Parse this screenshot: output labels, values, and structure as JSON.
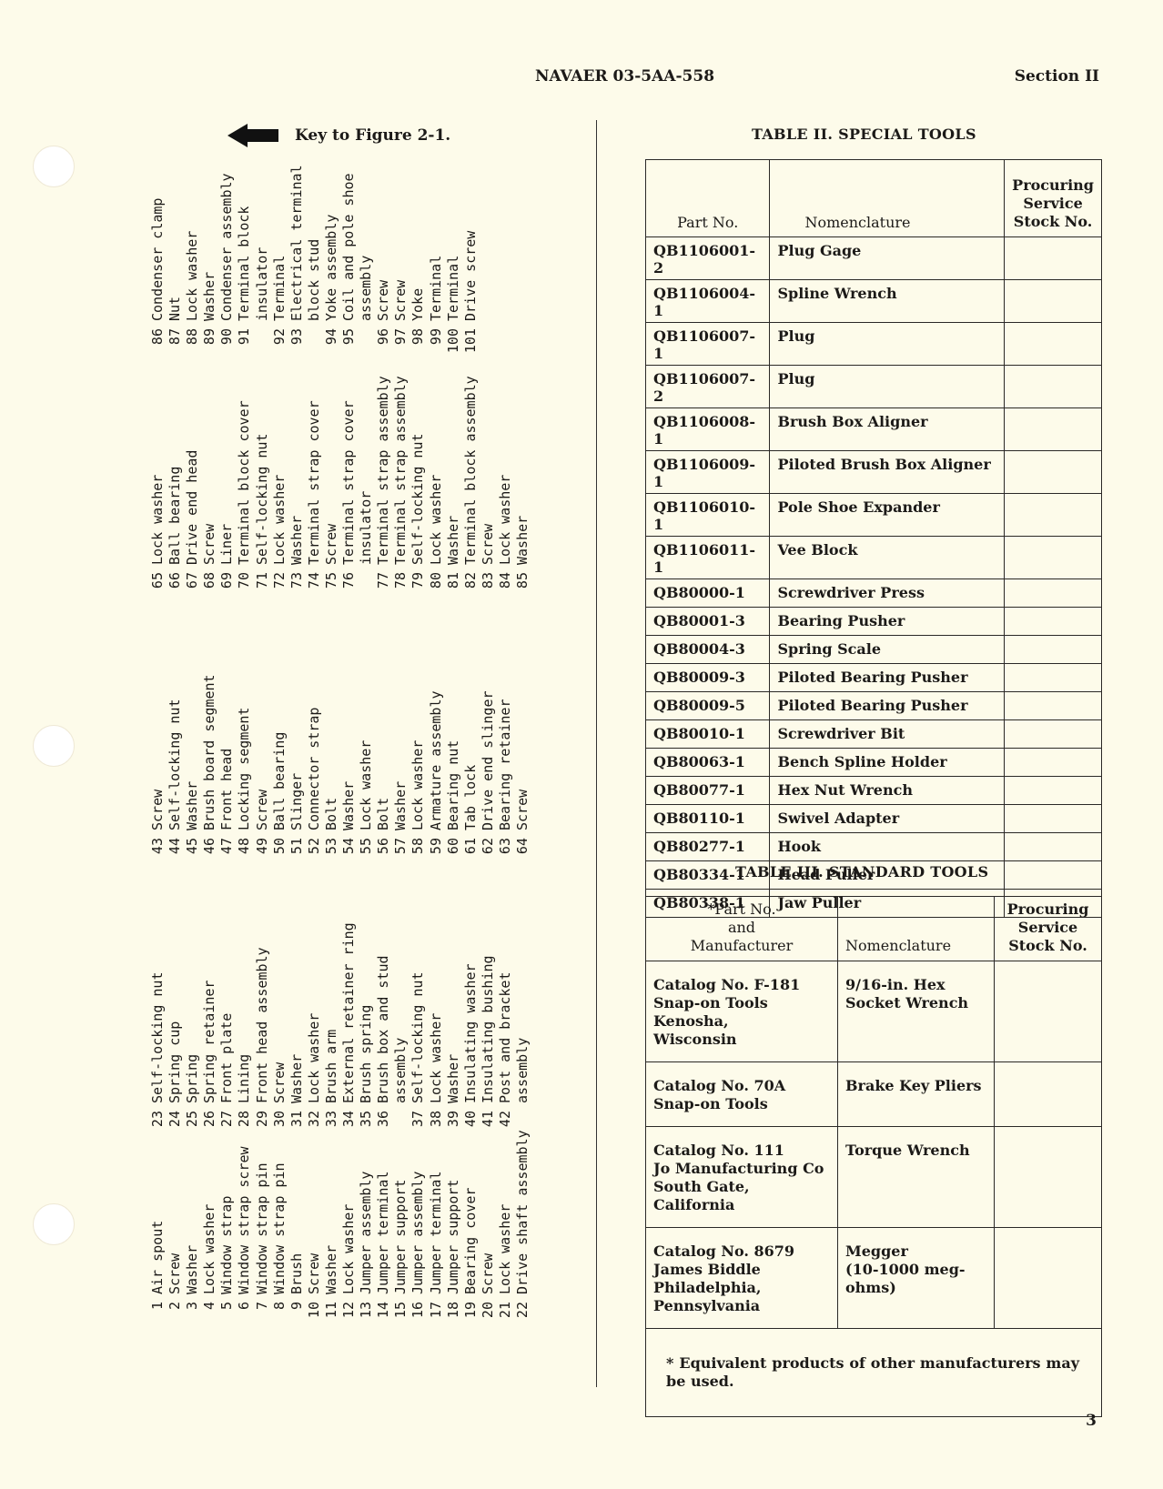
{
  "header": {
    "document_number": "NAVAER 03-5AA-558",
    "section": "Section II"
  },
  "key_heading": {
    "icon": "arrow-left-icon",
    "label": "Key to Figure 2-1."
  },
  "parts_list": {
    "col1": [
      {
        "n": "1",
        "t": "Air spout"
      },
      {
        "n": "2",
        "t": "Screw"
      },
      {
        "n": "3",
        "t": "Washer"
      },
      {
        "n": "4",
        "t": "Lock washer"
      },
      {
        "n": "5",
        "t": "Window strap"
      },
      {
        "n": "6",
        "t": "Window strap screw"
      },
      {
        "n": "7",
        "t": "Window strap pin"
      },
      {
        "n": "8",
        "t": "Window strap pin"
      },
      {
        "n": "9",
        "t": "Brush"
      },
      {
        "n": "10",
        "t": "Screw"
      },
      {
        "n": "11",
        "t": "Washer"
      },
      {
        "n": "12",
        "t": "Lock washer"
      },
      {
        "n": "13",
        "t": "Jumper assembly"
      },
      {
        "n": "14",
        "t": "Jumper terminal"
      },
      {
        "n": "15",
        "t": "Jumper support"
      },
      {
        "n": "16",
        "t": "Jumper assembly"
      },
      {
        "n": "17",
        "t": "Jumper terminal"
      },
      {
        "n": "18",
        "t": "Jumper support"
      },
      {
        "n": "19",
        "t": "Bearing cover"
      },
      {
        "n": "20",
        "t": "Screw"
      },
      {
        "n": "21",
        "t": "Lock washer"
      },
      {
        "n": "22",
        "t": "Drive shaft assembly"
      }
    ],
    "col2": [
      {
        "n": "23",
        "t": "Self-locking nut"
      },
      {
        "n": "24",
        "t": "Spring cup"
      },
      {
        "n": "25",
        "t": "Spring"
      },
      {
        "n": "26",
        "t": "Spring retainer"
      },
      {
        "n": "27",
        "t": "Front plate"
      },
      {
        "n": "28",
        "t": "Lining"
      },
      {
        "n": "29",
        "t": "Front head assembly"
      },
      {
        "n": "30",
        "t": "Screw"
      },
      {
        "n": "31",
        "t": "Washer"
      },
      {
        "n": "32",
        "t": "Lock washer"
      },
      {
        "n": "33",
        "t": "Brush arm"
      },
      {
        "n": "34",
        "t": "External retainer ring"
      },
      {
        "n": "35",
        "t": "Brush spring"
      },
      {
        "n": "36",
        "t": "Brush box and stud"
      },
      {
        "n": "",
        "t": "assembly"
      },
      {
        "n": "37",
        "t": "Self-locking nut"
      },
      {
        "n": "38",
        "t": "Lock washer"
      },
      {
        "n": "39",
        "t": "Washer"
      },
      {
        "n": "40",
        "t": "Insulating washer"
      },
      {
        "n": "41",
        "t": "Insulating bushing"
      },
      {
        "n": "42",
        "t": "Post and bracket"
      },
      {
        "n": "",
        "t": "assembly"
      }
    ],
    "col3": [
      {
        "n": "43",
        "t": "Screw"
      },
      {
        "n": "44",
        "t": "Self-locking nut"
      },
      {
        "n": "45",
        "t": "Washer"
      },
      {
        "n": "46",
        "t": "Brush board segment"
      },
      {
        "n": "47",
        "t": "Front head"
      },
      {
        "n": "48",
        "t": "Locking segment"
      },
      {
        "n": "49",
        "t": "Screw"
      },
      {
        "n": "50",
        "t": "Ball bearing"
      },
      {
        "n": "51",
        "t": "Slinger"
      },
      {
        "n": "52",
        "t": "Connector strap"
      },
      {
        "n": "53",
        "t": "Bolt"
      },
      {
        "n": "54",
        "t": "Washer"
      },
      {
        "n": "55",
        "t": "Lock washer"
      },
      {
        "n": "56",
        "t": "Bolt"
      },
      {
        "n": "57",
        "t": "Washer"
      },
      {
        "n": "58",
        "t": "Lock washer"
      },
      {
        "n": "59",
        "t": "Armature assembly"
      },
      {
        "n": "60",
        "t": "Bearing nut"
      },
      {
        "n": "61",
        "t": "Tab lock"
      },
      {
        "n": "62",
        "t": "Drive end slinger"
      },
      {
        "n": "63",
        "t": "Bearing retainer"
      },
      {
        "n": "64",
        "t": "Screw"
      }
    ],
    "col4": [
      {
        "n": "65",
        "t": "Lock washer"
      },
      {
        "n": "66",
        "t": "Ball bearing"
      },
      {
        "n": "67",
        "t": "Drive end head"
      },
      {
        "n": "68",
        "t": "Screw"
      },
      {
        "n": "69",
        "t": "Liner"
      },
      {
        "n": "70",
        "t": "Terminal block cover"
      },
      {
        "n": "71",
        "t": "Self-locking nut"
      },
      {
        "n": "72",
        "t": "Lock washer"
      },
      {
        "n": "73",
        "t": "Washer"
      },
      {
        "n": "74",
        "t": "Terminal strap cover"
      },
      {
        "n": "75",
        "t": "Screw"
      },
      {
        "n": "76",
        "t": "Terminal strap cover"
      },
      {
        "n": "",
        "t": "insulator"
      },
      {
        "n": "77",
        "t": "Terminal strap assembly"
      },
      {
        "n": "78",
        "t": "Terminal strap assembly"
      },
      {
        "n": "79",
        "t": "Self-locking nut"
      },
      {
        "n": "80",
        "t": "Lock washer"
      },
      {
        "n": "81",
        "t": "Washer"
      },
      {
        "n": "82",
        "t": "Terminal block assembly"
      },
      {
        "n": "83",
        "t": "Screw"
      },
      {
        "n": "84",
        "t": "Lock washer"
      },
      {
        "n": "85",
        "t": "Washer"
      }
    ],
    "col5": [
      {
        "n": "86",
        "t": "Condenser clamp"
      },
      {
        "n": "87",
        "t": "Nut"
      },
      {
        "n": "88",
        "t": "Lock washer"
      },
      {
        "n": "89",
        "t": "Washer"
      },
      {
        "n": "90",
        "t": "Condenser assembly"
      },
      {
        "n": "91",
        "t": "Terminal block"
      },
      {
        "n": "",
        "t": "insulator"
      },
      {
        "n": "92",
        "t": "Terminal"
      },
      {
        "n": "93",
        "t": "Electrical terminal"
      },
      {
        "n": "",
        "t": "block stud"
      },
      {
        "n": "94",
        "t": "Yoke assembly"
      },
      {
        "n": "95",
        "t": "Coil and pole shoe"
      },
      {
        "n": "",
        "t": "assembly"
      },
      {
        "n": "96",
        "t": "Screw"
      },
      {
        "n": "97",
        "t": "Screw"
      },
      {
        "n": "98",
        "t": "Yoke"
      },
      {
        "n": "99",
        "t": "Terminal"
      },
      {
        "n": "100",
        "t": "Terminal"
      },
      {
        "n": "101",
        "t": "Drive screw"
      }
    ]
  },
  "table2": {
    "title": "TABLE II.  SPECIAL TOOLS",
    "headers": [
      "Part No.",
      "Nomenclature",
      "Procuring Service Stock No."
    ],
    "header_lines": [
      "Procuring",
      "Service",
      "Stock No."
    ],
    "rows": [
      {
        "part": "QB1106001-2",
        "name": "Plug Gage",
        "stock": ""
      },
      {
        "part": "QB1106004-1",
        "name": "Spline Wrench",
        "stock": ""
      },
      {
        "part": "QB1106007-1",
        "name": "Plug",
        "stock": ""
      },
      {
        "part": "QB1106007-2",
        "name": "Plug",
        "stock": ""
      },
      {
        "part": "QB1106008-1",
        "name": "Brush Box Aligner",
        "stock": ""
      },
      {
        "part": "QB1106009-1",
        "name": "Piloted Brush Box Aligner",
        "stock": ""
      },
      {
        "part": "QB1106010-1",
        "name": "Pole Shoe Expander",
        "stock": ""
      },
      {
        "part": "QB1106011-1",
        "name": "Vee Block",
        "stock": ""
      },
      {
        "part": "QB80000-1",
        "name": "Screwdriver Press",
        "stock": ""
      },
      {
        "part": "QB80001-3",
        "name": "Bearing Pusher",
        "stock": ""
      },
      {
        "part": "QB80004-3",
        "name": "Spring Scale",
        "stock": ""
      },
      {
        "part": "QB80009-3",
        "name": "Piloted Bearing Pusher",
        "stock": ""
      },
      {
        "part": "QB80009-5",
        "name": "Piloted Bearing Pusher",
        "stock": ""
      },
      {
        "part": "QB80010-1",
        "name": "Screwdriver Bit",
        "stock": ""
      },
      {
        "part": "QB80063-1",
        "name": "Bench Spline Holder",
        "stock": ""
      },
      {
        "part": "QB80077-1",
        "name": "Hex Nut Wrench",
        "stock": ""
      },
      {
        "part": "QB80110-1",
        "name": "Swivel Adapter",
        "stock": ""
      },
      {
        "part": "QB80277-1",
        "name": "Hook",
        "stock": ""
      },
      {
        "part": "QB80334-1",
        "name": "Head Puller",
        "stock": ""
      },
      {
        "part": "QB80338-1",
        "name": "Jaw Puller",
        "stock": ""
      }
    ]
  },
  "table3": {
    "title": "TABLE III.   STANDARD TOOLS",
    "header_col1_lines": [
      "*Part No.",
      "and",
      "Manufacturer"
    ],
    "header_col2": "Nomenclature",
    "header_col3_lines": [
      "Procuring",
      "Service",
      "Stock No."
    ],
    "rows": [
      {
        "part_lines": [
          "Catalog No.  F-181",
          "Snap-on Tools",
          "Kenosha,",
          "Wisconsin"
        ],
        "name_lines": [
          "9/16-in.  Hex",
          "Socket Wrench"
        ],
        "stock": ""
      },
      {
        "part_lines": [
          "Catalog No.  70A",
          "Snap-on Tools"
        ],
        "name_lines": [
          "Brake Key Pliers"
        ],
        "stock": ""
      },
      {
        "part_lines": [
          "Catalog No.  111",
          "Jo Manufacturing Co",
          "South Gate,",
          "California"
        ],
        "name_lines": [
          "Torque Wrench"
        ],
        "stock": ""
      },
      {
        "part_lines": [
          "Catalog No.  8679",
          "James Biddle",
          "Philadelphia,",
          "Pennsylvania"
        ],
        "name_lines": [
          "Megger",
          "(10-1000 meg-",
          "ohms)"
        ],
        "stock": ""
      }
    ],
    "footnote_marker": "*",
    "footnote": "Equivalent products of other manufacturers may be used."
  },
  "footer": {
    "page_number": "3"
  }
}
